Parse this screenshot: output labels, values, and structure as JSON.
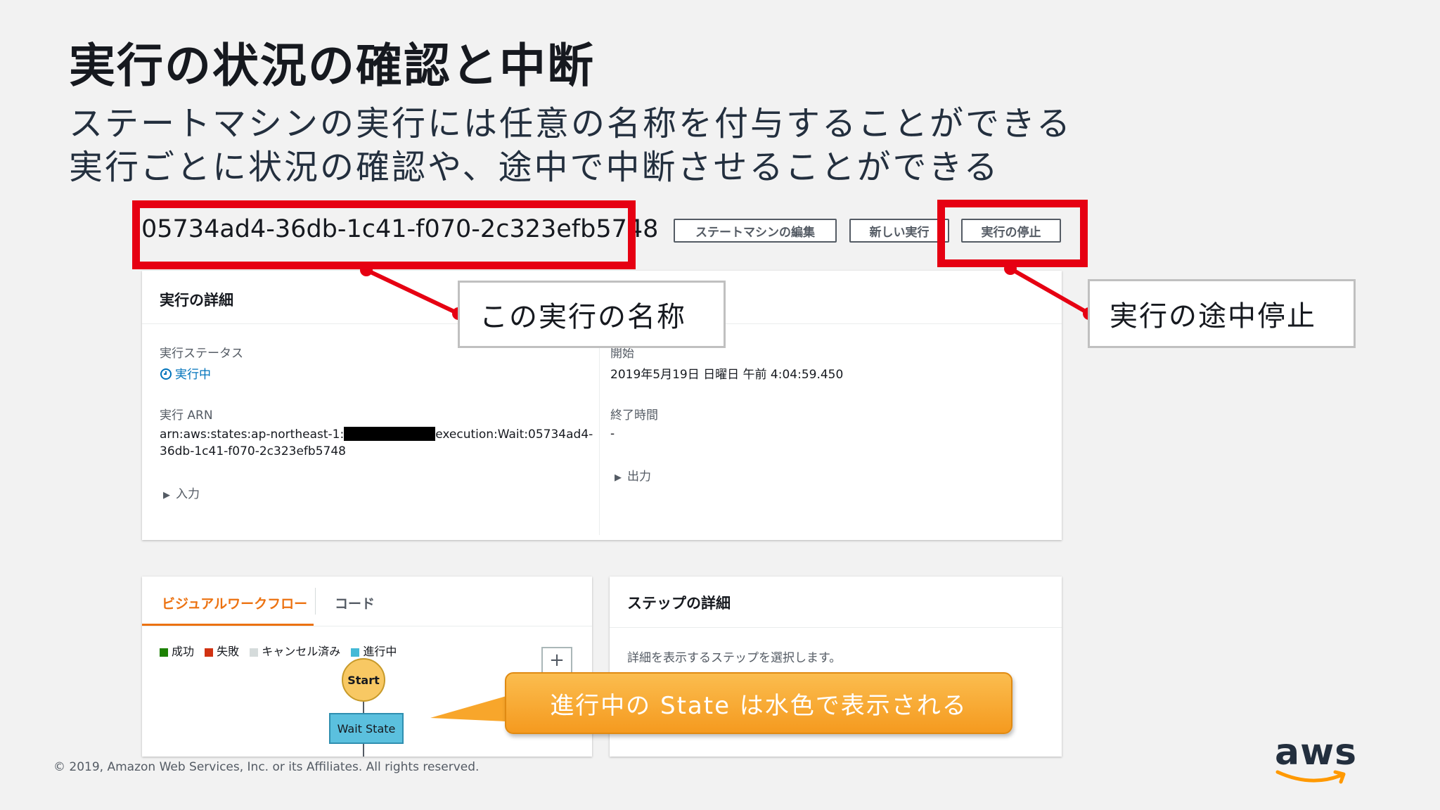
{
  "slide": {
    "title": "実行の状況の確認と中断",
    "bullets": [
      "ステートマシンの実行には任意の名称を付与することができる",
      "実行ごとに状況の確認や、途中で中断させることができる"
    ],
    "footer": "© 2019, Amazon Web Services, Inc. or its Affiliates. All rights reserved.",
    "logo_text": "aws"
  },
  "execution": {
    "name": "05734ad4-36db-1c41-f070-2c323efb5748",
    "buttons": {
      "edit": "ステートマシンの編集",
      "new": "新しい実行",
      "stop": "実行の停止"
    }
  },
  "details": {
    "header": "実行の詳細",
    "status_label": "実行ステータス",
    "status_value": "実行中",
    "arn_label": "実行 ARN",
    "arn_line1_prefix": "arn:aws:states:ap-northeast-1:",
    "arn_line1_suffix": "execution:Wait:05734ad4-",
    "arn_line2": "36db-1c41-f070-2c323efb5748",
    "input_label": "入力",
    "start_label": "開始",
    "start_value": "2019年5月19日 日曜日 午前 4:04:59.450",
    "end_label": "終了時間",
    "end_value": "-",
    "output_label": "出力"
  },
  "workflow": {
    "tabs": [
      "ビジュアルワークフロー",
      "コード"
    ],
    "legend": [
      {
        "label": "成功",
        "color": "#1d8102"
      },
      {
        "label": "失敗",
        "color": "#d13212"
      },
      {
        "label": "キャンセル済み",
        "color": "#d5dbdb"
      },
      {
        "label": "進行中",
        "color": "#44b9d6"
      }
    ],
    "nodes": {
      "start": "Start",
      "wait": "Wait State"
    },
    "zoom_in": "+"
  },
  "step_details": {
    "header": "ステップの詳細",
    "hint": "詳細を表示するステップを選択します。"
  },
  "annotations": {
    "name_callout": "この実行の名称",
    "stop_callout": "実行の途中停止",
    "state_callout": "進行中の State は水色で表示される"
  },
  "colors": {
    "highlight": "#e60012",
    "link": "#0073bb",
    "tab_active": "#ec7211",
    "in_progress": "#5bc0de",
    "start_node": "#f8c863",
    "callout_orange": "#f8a62b",
    "aws_smile": "#ff9900"
  }
}
